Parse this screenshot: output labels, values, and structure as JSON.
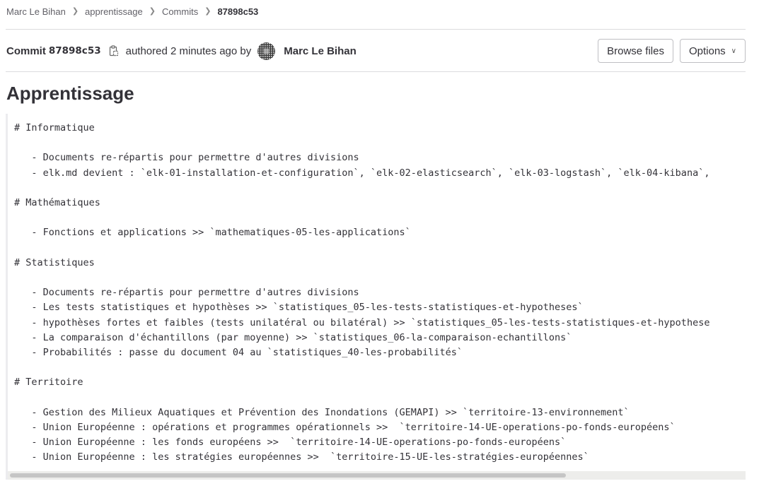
{
  "breadcrumb": {
    "items": [
      "Marc Le Bihan",
      "apprentissage",
      "Commits"
    ],
    "current": "87898c53"
  },
  "commit": {
    "label": "Commit",
    "sha": "87898c53",
    "authored_text": "authored 2 minutes ago by",
    "author": "Marc Le Bihan",
    "title": "Apprentissage",
    "description_lines": [
      "# Informatique",
      "",
      "   - Documents re-répartis pour permettre d'autres divisions",
      "   - elk.md devient : `elk-01-installation-et-configuration`, `elk-02-elasticsearch`, `elk-03-logstash`, `elk-04-kibana`,",
      "",
      "# Mathématiques",
      "",
      "   - Fonctions et applications >> `mathematiques-05-les-applications`",
      "",
      "# Statistiques",
      "",
      "   - Documents re-répartis pour permettre d'autres divisions",
      "   - Les tests statistiques et hypothèses >> `statistiques_05-les-tests-statistiques-et-hypotheses`",
      "   - hypothèses fortes et faibles (tests unilatéral ou bilatéral) >> `statistiques_05-les-tests-statistiques-et-hypothese",
      "   - La comparaison d'échantillons (par moyenne) >> `statistiques_06-la-comparaison-echantillons`",
      "   - Probabilités : passe du document 04 au `statistiques_40-les-probabilités`",
      "",
      "# Territoire",
      "",
      "   - Gestion des Milieux Aquatiques et Prévention des Inondations (GEMAPI) >> `territoire-13-environnement`",
      "   - Union Européenne : opérations et programmes opérationnels >>  `territoire-14-UE-operations-po-fonds-européens`",
      "   - Union Européenne : les fonds européens >>  `territoire-14-UE-operations-po-fonds-européens`",
      "   - Union Européenne : les stratégies européennes >>  `territoire-15-UE-les-stratégies-européennes`"
    ]
  },
  "actions": {
    "browse_files": "Browse files",
    "options": "Options"
  },
  "icons": {
    "breadcrumb_separator": "chevron-right-icon",
    "copy": "copy-to-clipboard-icon",
    "options_chevron": "chevron-down-icon"
  }
}
